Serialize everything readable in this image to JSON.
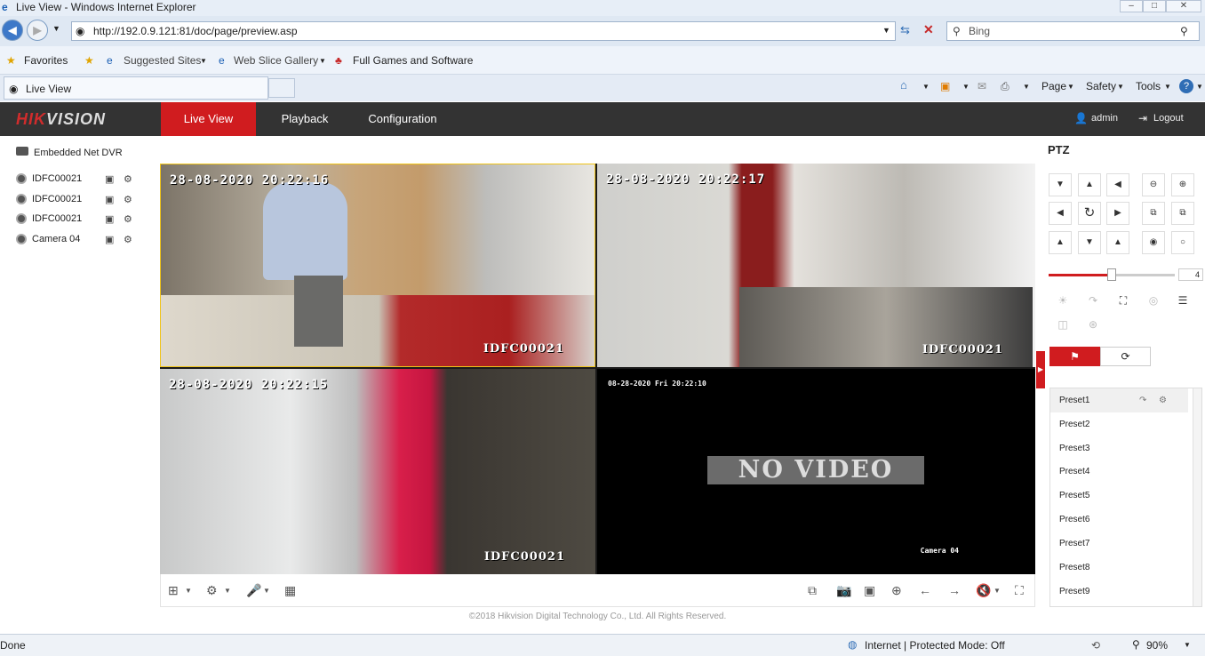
{
  "browser": {
    "window_title": "Live View - Windows Internet Explorer",
    "url": "http://192.0.9.121:81/doc/page/preview.asp",
    "search_placeholder": "Bing",
    "favorites_label": "Favorites",
    "fav_links": [
      "Suggested Sites",
      "Web Slice Gallery",
      "Full Games and Software"
    ],
    "tab_title": "Live View",
    "commands": [
      "Page",
      "Safety",
      "Tools"
    ],
    "status_left": "Done",
    "status_zone": "Internet | Protected Mode: Off",
    "zoom": "90%"
  },
  "app": {
    "logo_red": "HIK",
    "logo_white": "VISION",
    "nav": [
      "Live View",
      "Playback",
      "Configuration"
    ],
    "active_nav": "Live View",
    "user": "admin",
    "logout": "Logout",
    "copyright": "©2018 Hikvision Digital Technology Co., Ltd. All Rights Reserved."
  },
  "device_tree": {
    "root": "Embedded Net DVR",
    "cameras": [
      "IDFC00021",
      "IDFC00021",
      "IDFC00021",
      "Camera 04"
    ]
  },
  "video": {
    "tiles": [
      {
        "timestamp": "28-08-2020 20:22:16",
        "name": "IDFC00021"
      },
      {
        "timestamp": "28-08-2020 20:22:17",
        "name": "IDFC00021"
      },
      {
        "timestamp": "28-08-2020 20:22:15",
        "name": "IDFC00021"
      },
      {
        "timestamp": "08-28-2020 Fri 20:22:10",
        "name": "Camera 04",
        "overlay": "NO VIDEO"
      }
    ]
  },
  "ptz": {
    "title": "PTZ",
    "speed": "4",
    "speed_level": 0.5,
    "presets": [
      "Preset1",
      "Preset2",
      "Preset3",
      "Preset4",
      "Preset5",
      "Preset6",
      "Preset7",
      "Preset8",
      "Preset9"
    ],
    "selected_preset": "Preset1"
  },
  "colors": {
    "accent": "#d01c1f",
    "header_bg": "#333333",
    "selected_tile_border": "#f0c419"
  }
}
